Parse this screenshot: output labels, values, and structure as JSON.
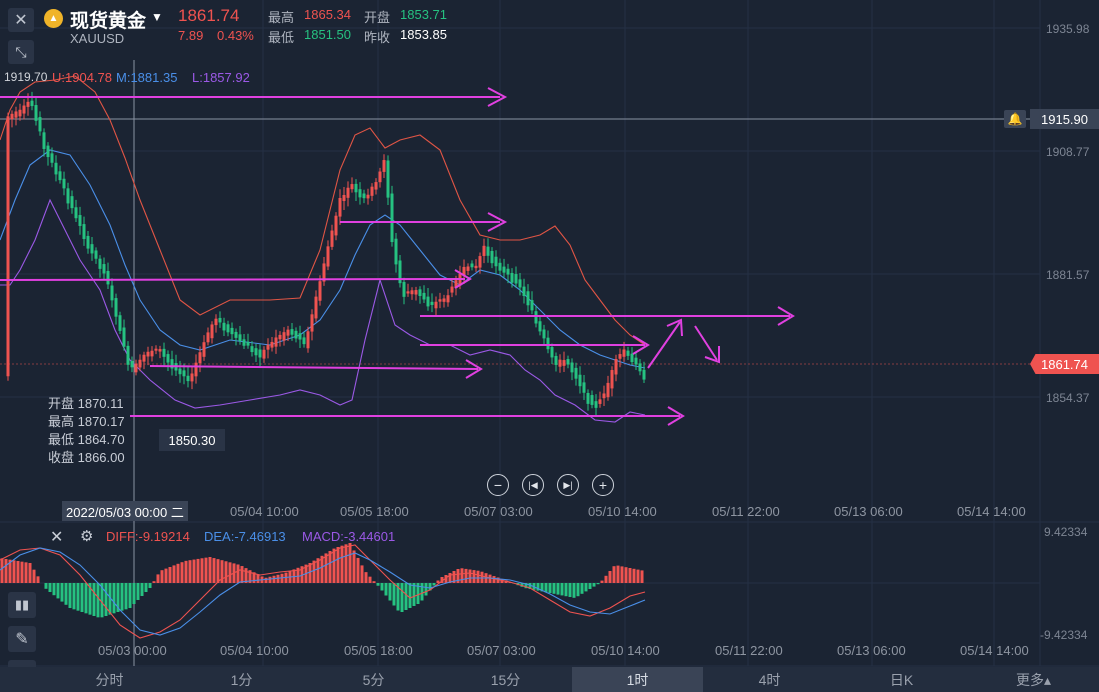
{
  "header": {
    "title": "现货黄金",
    "symbol": "XAUUSD",
    "price": "1861.74",
    "change": "7.89",
    "change_pct": "0.43%",
    "high_label": "最高",
    "high_value": "1865.34",
    "open_label": "开盘",
    "open_value": "1853.71",
    "low_label": "最低",
    "low_value": "1851.50",
    "prev_label": "昨收",
    "prev_value": "1853.85"
  },
  "boll": {
    "prefix": "1919.70",
    "upper": "U:1904.78",
    "mid": "M:1881.35",
    "lower": "L:1857.92"
  },
  "y_axis": [
    "1935.98",
    "1908.77",
    "1881.57",
    "1854.37"
  ],
  "crosshair_price": "1915.90",
  "current_price_tag": "1861.74",
  "ohlc_tooltip": {
    "open": "开盘 1870.11",
    "high": "最高 1870.17",
    "low": "最低 1864.70",
    "close": "收盘 1866.00"
  },
  "low_marker": "1850.30",
  "x_axis_main": [
    "05/04 10:00",
    "05/05 18:00",
    "05/07 03:00",
    "05/10 14:00",
    "05/11 22:00",
    "05/13 06:00",
    "05/14 14:00"
  ],
  "crosshair_time": "2022/05/03 00:00 二",
  "macd": {
    "diff": "DIFF:-9.19214",
    "dea": "DEA:-7.46913",
    "macd": "MACD:-3.44601",
    "y_top": "9.42334",
    "y_bottom": "-9.42334"
  },
  "x_axis_macd": [
    "05/03 00:00",
    "05/04 10:00",
    "05/05 18:00",
    "05/07 03:00",
    "05/10 14:00",
    "05/11 22:00",
    "05/13 06:00",
    "05/14 14:00"
  ],
  "tabs": [
    "分时",
    "1分",
    "5分",
    "15分",
    "1时",
    "4时",
    "日K",
    "更多▴"
  ],
  "active_tab": "1时",
  "colors": {
    "up": "#ef5350",
    "down": "#26c281",
    "annotation": "#e040e0",
    "bg": "#1b2433",
    "mid": "#4a8fe8",
    "lower": "#9b59e6"
  },
  "icons": [
    "close-icon",
    "collapse-icon",
    "candle-icon",
    "pen-icon",
    "indicator-icon",
    "bell-icon",
    "gear-icon"
  ]
}
